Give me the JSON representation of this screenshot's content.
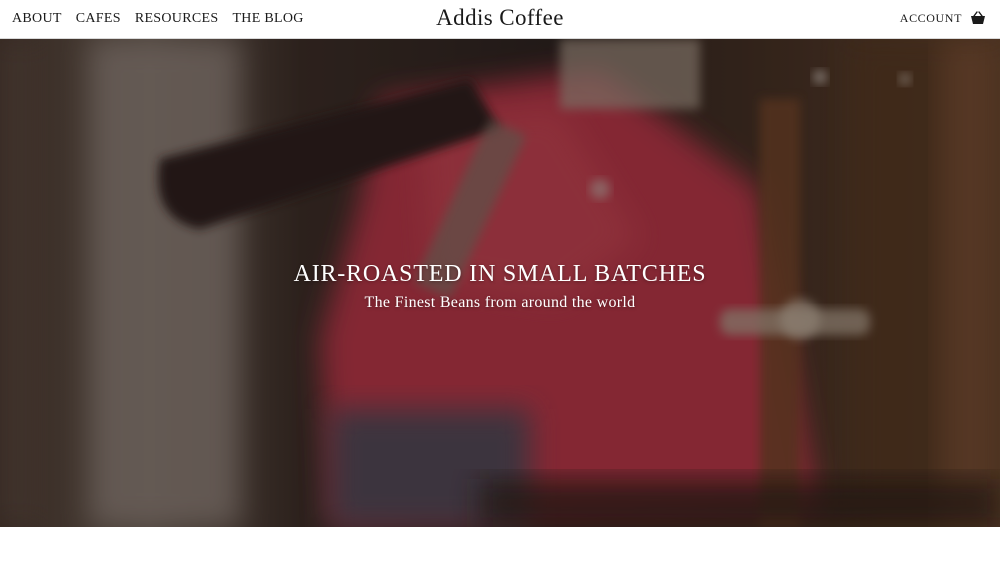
{
  "header": {
    "nav": [
      "ABOUT",
      "CAFES",
      "RESOURCES",
      "THE BLOG"
    ],
    "brand": "Addis Coffee",
    "account_label": "ACCOUNT",
    "cart_icon": "basket-icon"
  },
  "hero": {
    "title": "AIR-ROASTED IN SMALL BATCHES",
    "subtitle": "The Finest Beans from around the world",
    "accent": "#c8384e"
  }
}
